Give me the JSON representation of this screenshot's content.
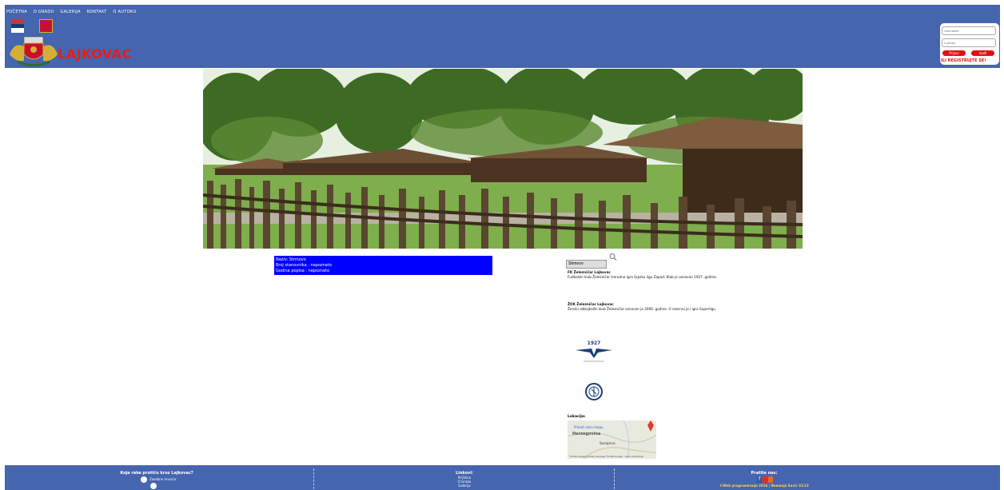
{
  "nav": [
    "POČETNA",
    "O GRADU",
    "GALERIJA",
    "KONTAKT",
    "O AUTORU"
  ],
  "logo_text": "LAJKOVAC",
  "login": {
    "username_placeholder": "Username",
    "password_placeholder": "Lozinka",
    "login_button": "Prijavi",
    "register_button": "Izađi",
    "register_text": "ILI REGISTRUJTE SE!"
  },
  "info": {
    "naziv": "Naziv: Strmovo",
    "stanovnika": "Broj stanovnika : nepoznato",
    "popis": "Godina popisa : nepoznato"
  },
  "search": {
    "value": "Strmovo"
  },
  "clubs": [
    {
      "name": "FK Železničar Lajkovac",
      "desc": "Fudbalski klub Železničar trenutno igra Srpsku ligu Zapad. Klub je osnovan 1927. godine."
    },
    {
      "name": "ŽOK Železničar Lajkovac",
      "desc": "Ženski odbojkaški klub Železničar osnovan je 2006. godine. U rezervu je i igra Superligu."
    }
  ],
  "club_logo_year": "1927",
  "map": {
    "label": "Lokacija:",
    "link": "Prikaži veću mapu",
    "region": "Herzegovina",
    "city": "Sarajevo",
    "footer_note": "©2016 Google | Podaci sa mape ©2016 Google · Uslovi korišćenja"
  },
  "footer": {
    "poll_title": "Koje reke protiču kroz Lajkovac?",
    "poll_option": "Zasebne munice",
    "links_title": "Linkovi:",
    "links": [
      "Početna",
      "O Gradu",
      "Galerija"
    ],
    "follow_title": "Pratite nas:",
    "copyright": "©Web programiranje 2016 | Nemanja Savić 31/13"
  },
  "colors": {
    "header": "#4565ae",
    "accent_red": "#e81b1b",
    "info_blue": "#0000ff"
  }
}
